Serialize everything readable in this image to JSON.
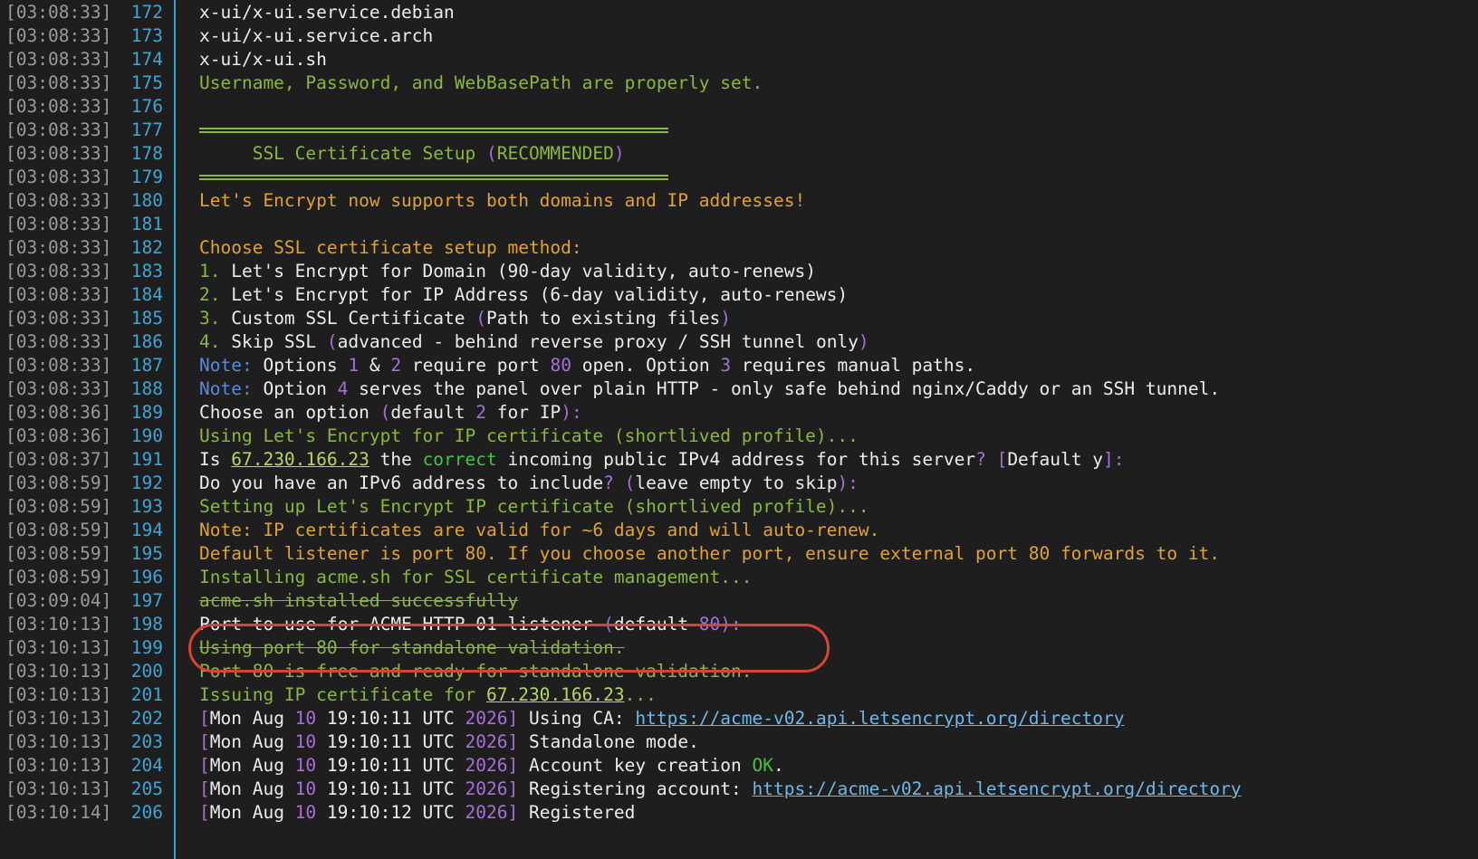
{
  "terminal": {
    "lines": [
      {
        "ts": "[03:08:33]",
        "ln": "172",
        "segs": [
          {
            "t": "x-ui/x-ui.service.debian",
            "c": "w"
          }
        ]
      },
      {
        "ts": "[03:08:33]",
        "ln": "173",
        "segs": [
          {
            "t": "x-ui/x-ui.service.arch",
            "c": "w"
          }
        ]
      },
      {
        "ts": "[03:08:33]",
        "ln": "174",
        "segs": [
          {
            "t": "x-ui/x-ui.sh",
            "c": "w"
          }
        ]
      },
      {
        "ts": "[03:08:33]",
        "ln": "175",
        "segs": [
          {
            "t": "Username, Password, and WebBasePath are properly set.",
            "c": "g"
          }
        ]
      },
      {
        "ts": "[03:08:33]",
        "ln": "176",
        "segs": []
      },
      {
        "ts": "[03:08:33]",
        "ln": "177",
        "rule": true,
        "segs": []
      },
      {
        "ts": "[03:08:33]",
        "ln": "178",
        "segs": [
          {
            "t": "     SSL Certificate Setup ",
            "c": "g"
          },
          {
            "t": "(",
            "c": "p"
          },
          {
            "t": "RECOMMENDED",
            "c": "g"
          },
          {
            "t": ")",
            "c": "p"
          }
        ]
      },
      {
        "ts": "[03:08:33]",
        "ln": "179",
        "rule": true,
        "segs": []
      },
      {
        "ts": "[03:08:33]",
        "ln": "180",
        "segs": [
          {
            "t": "Let's Encrypt now supports both domains and IP addresses!",
            "c": "y"
          }
        ]
      },
      {
        "ts": "[03:08:33]",
        "ln": "181",
        "segs": []
      },
      {
        "ts": "[03:08:33]",
        "ln": "182",
        "segs": [
          {
            "t": "Choose SSL certificate setup method:",
            "c": "y"
          }
        ]
      },
      {
        "ts": "[03:08:33]",
        "ln": "183",
        "segs": [
          {
            "t": "1. ",
            "c": "g"
          },
          {
            "t": "Let's Encrypt for Domain (90-day validity, auto-renews)",
            "c": "w"
          }
        ]
      },
      {
        "ts": "[03:08:33]",
        "ln": "184",
        "segs": [
          {
            "t": "2. ",
            "c": "g"
          },
          {
            "t": "Let's Encrypt for IP Address (6-day validity, auto-renews)",
            "c": "w"
          }
        ]
      },
      {
        "ts": "[03:08:33]",
        "ln": "185",
        "segs": [
          {
            "t": "3. ",
            "c": "g"
          },
          {
            "t": "Custom SSL Certificate ",
            "c": "w"
          },
          {
            "t": "(",
            "c": "p"
          },
          {
            "t": "Path to existing files",
            "c": "w"
          },
          {
            "t": ")",
            "c": "p"
          }
        ]
      },
      {
        "ts": "[03:08:33]",
        "ln": "186",
        "segs": [
          {
            "t": "4. ",
            "c": "g"
          },
          {
            "t": "Skip SSL ",
            "c": "w"
          },
          {
            "t": "(",
            "c": "p"
          },
          {
            "t": "advanced - behind reverse proxy / SSH tunnel only",
            "c": "w"
          },
          {
            "t": ")",
            "c": "p"
          }
        ]
      },
      {
        "ts": "[03:08:33]",
        "ln": "187",
        "segs": [
          {
            "t": "Note: ",
            "c": "b"
          },
          {
            "t": "Options ",
            "c": "w"
          },
          {
            "t": "1",
            "c": "p"
          },
          {
            "t": " & ",
            "c": "w"
          },
          {
            "t": "2",
            "c": "p"
          },
          {
            "t": " require port ",
            "c": "w"
          },
          {
            "t": "80",
            "c": "p"
          },
          {
            "t": " open. Option ",
            "c": "w"
          },
          {
            "t": "3",
            "c": "p"
          },
          {
            "t": " requires manual paths.",
            "c": "w"
          }
        ]
      },
      {
        "ts": "[03:08:33]",
        "ln": "188",
        "segs": [
          {
            "t": "Note: ",
            "c": "b"
          },
          {
            "t": "Option ",
            "c": "w"
          },
          {
            "t": "4",
            "c": "p"
          },
          {
            "t": " serves the panel over plain HTTP - only safe behind nginx/Caddy or an SSH tunnel.",
            "c": "w"
          }
        ]
      },
      {
        "ts": "[03:08:36]",
        "ln": "189",
        "segs": [
          {
            "t": "Choose an option ",
            "c": "w"
          },
          {
            "t": "(",
            "c": "p"
          },
          {
            "t": "default ",
            "c": "w"
          },
          {
            "t": "2",
            "c": "p"
          },
          {
            "t": " for IP",
            "c": "w"
          },
          {
            "t": "):",
            "c": "p"
          }
        ]
      },
      {
        "ts": "[03:08:36]",
        "ln": "190",
        "segs": [
          {
            "t": "Using Let's Encrypt for IP certificate (shortlived profile)...",
            "c": "g"
          }
        ]
      },
      {
        "ts": "[03:08:37]",
        "ln": "191",
        "segs": [
          {
            "t": "Is ",
            "c": "w"
          },
          {
            "t": "67.230.166.23",
            "c": "u"
          },
          {
            "t": " the ",
            "c": "w"
          },
          {
            "t": "correct",
            "c": "gb"
          },
          {
            "t": " incoming public IPv4 address for this server",
            "c": "w"
          },
          {
            "t": "?",
            "c": "p"
          },
          {
            "t": " ",
            "c": "w"
          },
          {
            "t": "[",
            "c": "p"
          },
          {
            "t": "Default y",
            "c": "w"
          },
          {
            "t": "]:",
            "c": "p"
          }
        ]
      },
      {
        "ts": "[03:08:59]",
        "ln": "192",
        "segs": [
          {
            "t": "Do you have an IPv6 address to include",
            "c": "w"
          },
          {
            "t": "?",
            "c": "p"
          },
          {
            "t": " ",
            "c": "w"
          },
          {
            "t": "(",
            "c": "p"
          },
          {
            "t": "leave empty to skip",
            "c": "w"
          },
          {
            "t": "):",
            "c": "p"
          }
        ]
      },
      {
        "ts": "[03:08:59]",
        "ln": "193",
        "segs": [
          {
            "t": "Setting up Let's Encrypt IP certificate (shortlived profile)...",
            "c": "g"
          }
        ]
      },
      {
        "ts": "[03:08:59]",
        "ln": "194",
        "segs": [
          {
            "t": "Note: IP certificates are valid for ~6 days and will auto-renew.",
            "c": "y"
          }
        ]
      },
      {
        "ts": "[03:08:59]",
        "ln": "195",
        "segs": [
          {
            "t": "Default listener is port 80. If you choose another port, ensure external port 80 forwards to it.",
            "c": "y"
          }
        ]
      },
      {
        "ts": "[03:08:59]",
        "ln": "196",
        "segs": [
          {
            "t": "Installing acme.sh for SSL certificate management...",
            "c": "g"
          }
        ]
      },
      {
        "ts": "[03:09:04]",
        "ln": "197",
        "segs": [
          {
            "t": "acme.sh installed successfully",
            "c": "g",
            "s": true
          }
        ]
      },
      {
        "ts": "[03:10:13]",
        "ln": "198",
        "segs": [
          {
            "t": "Port to use for ACME HTTP-01 listener ",
            "c": "w"
          },
          {
            "t": "(",
            "c": "p"
          },
          {
            "t": "default ",
            "c": "w"
          },
          {
            "t": "80",
            "c": "p"
          },
          {
            "t": "):",
            "c": "p"
          }
        ]
      },
      {
        "ts": "[03:10:13]",
        "ln": "199",
        "segs": [
          {
            "t": "Using port 80 for standalone validation.",
            "c": "g",
            "s": true
          }
        ]
      },
      {
        "ts": "[03:10:13]",
        "ln": "200",
        "segs": [
          {
            "t": "Port 80 is free and ready for standalone validation.",
            "c": "g"
          }
        ]
      },
      {
        "ts": "[03:10:13]",
        "ln": "201",
        "segs": [
          {
            "t": "Issuing IP certificate for ",
            "c": "g"
          },
          {
            "t": "67.230.166.23",
            "c": "u"
          },
          {
            "t": "...",
            "c": "g"
          }
        ]
      },
      {
        "ts": "[03:10:13]",
        "ln": "202",
        "segs": [
          {
            "t": "[",
            "c": "p"
          },
          {
            "t": "Mon Aug ",
            "c": "w"
          },
          {
            "t": "10",
            "c": "p"
          },
          {
            "t": " 19:10:11 UTC ",
            "c": "w"
          },
          {
            "t": "2026",
            "c": "p"
          },
          {
            "t": "]",
            "c": "p"
          },
          {
            "t": " Using CA: ",
            "c": "w"
          },
          {
            "t": "https://acme-v02.api.letsencrypt.org/directory",
            "c": "ub"
          }
        ]
      },
      {
        "ts": "[03:10:13]",
        "ln": "203",
        "segs": [
          {
            "t": "[",
            "c": "p"
          },
          {
            "t": "Mon Aug ",
            "c": "w"
          },
          {
            "t": "10",
            "c": "p"
          },
          {
            "t": " 19:10:11 UTC ",
            "c": "w"
          },
          {
            "t": "2026",
            "c": "p"
          },
          {
            "t": "]",
            "c": "p"
          },
          {
            "t": " Standalone mode.",
            "c": "w"
          }
        ]
      },
      {
        "ts": "[03:10:13]",
        "ln": "204",
        "segs": [
          {
            "t": "[",
            "c": "p"
          },
          {
            "t": "Mon Aug ",
            "c": "w"
          },
          {
            "t": "10",
            "c": "p"
          },
          {
            "t": " 19:10:11 UTC ",
            "c": "w"
          },
          {
            "t": "2026",
            "c": "p"
          },
          {
            "t": "]",
            "c": "p"
          },
          {
            "t": " Account key creation ",
            "c": "w"
          },
          {
            "t": "OK",
            "c": "gb"
          },
          {
            "t": ".",
            "c": "w"
          }
        ]
      },
      {
        "ts": "[03:10:13]",
        "ln": "205",
        "segs": [
          {
            "t": "[",
            "c": "p"
          },
          {
            "t": "Mon Aug ",
            "c": "w"
          },
          {
            "t": "10",
            "c": "p"
          },
          {
            "t": " 19:10:11 UTC ",
            "c": "w"
          },
          {
            "t": "2026",
            "c": "p"
          },
          {
            "t": "]",
            "c": "p"
          },
          {
            "t": " Registering account: ",
            "c": "w"
          },
          {
            "t": "https://acme-v02.api.letsencrypt.org/directory",
            "c": "ub"
          }
        ]
      },
      {
        "ts": "[03:10:14]",
        "ln": "206",
        "segs": [
          {
            "t": "[",
            "c": "p"
          },
          {
            "t": "Mon Aug ",
            "c": "w"
          },
          {
            "t": "10",
            "c": "p"
          },
          {
            "t": " 19:10:12 UTC ",
            "c": "w"
          },
          {
            "t": "2026",
            "c": "p"
          },
          {
            "t": "]",
            "c": "p"
          },
          {
            "t": " Registered",
            "c": "w"
          }
        ]
      }
    ]
  },
  "colors": {
    "background": "#1e1e1e",
    "gutter": "#2aa7d6",
    "highlight_ring": "#d9432f"
  },
  "highlight": {
    "target_line": "198"
  }
}
